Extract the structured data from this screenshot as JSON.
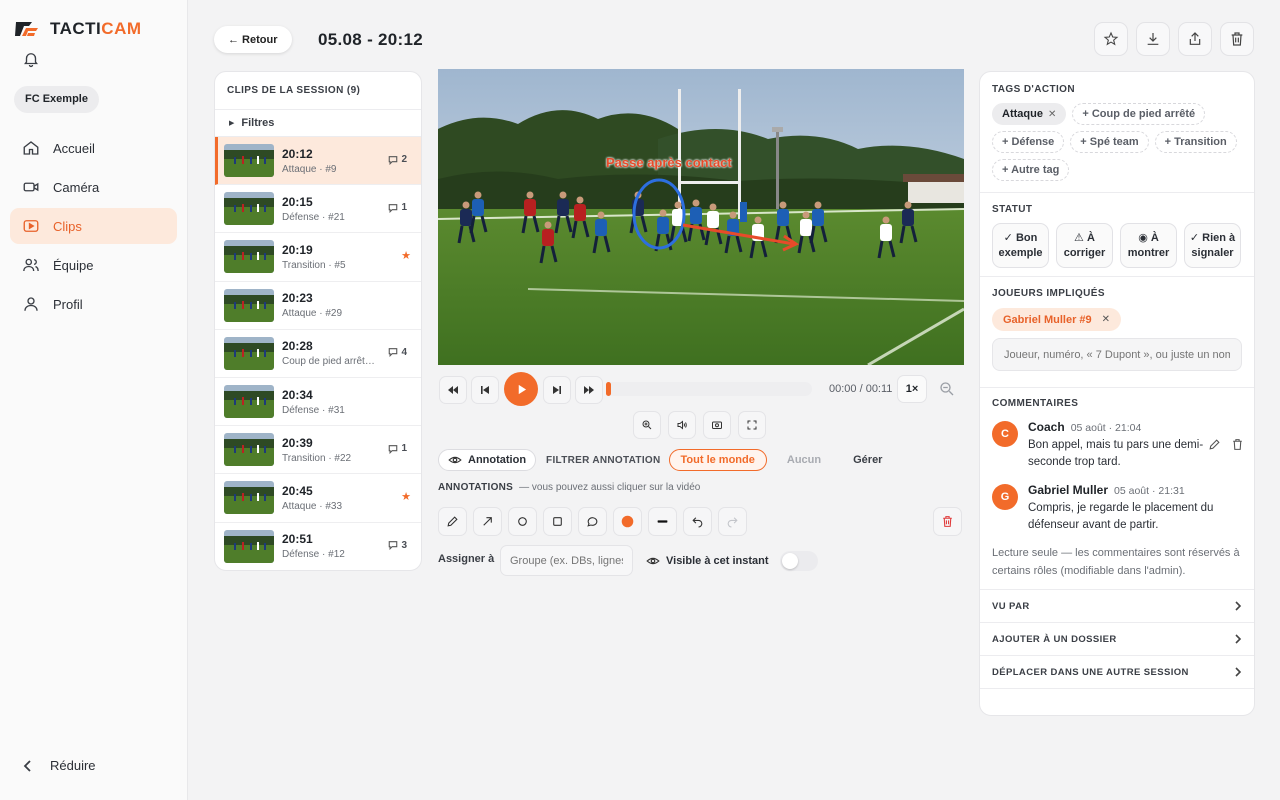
{
  "app": {
    "brand_prefix": "TACTI",
    "brand_suffix": "CAM",
    "team": "FC Exemple",
    "accent": "#f26b2a"
  },
  "nav": {
    "items": [
      {
        "label": "Accueil",
        "icon": "home-icon"
      },
      {
        "label": "Caméra",
        "icon": "camera-icon"
      },
      {
        "label": "Clips",
        "icon": "clips-icon",
        "active": true
      },
      {
        "label": "Équipe",
        "icon": "team-icon"
      },
      {
        "label": "Profil",
        "icon": "profile-icon"
      }
    ],
    "collapse": "Réduire"
  },
  "header": {
    "back": "← Retour",
    "title": "05.08 - 20:12"
  },
  "clips": {
    "title": "CLIPS DE LA SESSION (9)",
    "filters": "Filtres",
    "items": [
      {
        "time": "20:12",
        "sub": "Attaque · #9",
        "badge": "2"
      },
      {
        "time": "20:15",
        "sub": "Défense · #21",
        "badge": "1"
      },
      {
        "time": "20:19",
        "sub": "Transition · #5",
        "badge": "★"
      },
      {
        "time": "20:23",
        "sub": "Attaque · #29",
        "badge": ""
      },
      {
        "time": "20:28",
        "sub": "Coup de pied arrêt…",
        "badge": "4"
      },
      {
        "time": "20:34",
        "sub": "Défense · #31",
        "badge": ""
      },
      {
        "time": "20:39",
        "sub": "Transition · #22",
        "badge": "1"
      },
      {
        "time": "20:45",
        "sub": "Attaque · #33",
        "badge": "★"
      },
      {
        "time": "20:51",
        "sub": "Défense · #12",
        "badge": "3"
      }
    ]
  },
  "video": {
    "overlay_label": "Passe après contact",
    "time": "00:00 / 00:11",
    "speed": "1×",
    "progress": 0
  },
  "annotation": {
    "toggle": "Annotation",
    "filter_label": "FILTRER ANNOTATION",
    "filters": [
      "Tout le monde",
      "Aucun",
      "Gérer"
    ],
    "title": "ANNOTATIONS",
    "hint": "— vous pouvez aussi cliquer sur la vidéo",
    "assign_label": "Assigner à",
    "assign_placeholder": "Groupe (ex. DBs, lignes…)",
    "visible_label": "Visible à cet instant",
    "color": "#f26b2a"
  },
  "tags": {
    "title": "TAGS D'ACTION",
    "active": "Attaque",
    "options": [
      "+ Coup de pied arrêté",
      "+ Défense",
      "+ Spé team",
      "+ Transition",
      "+ Autre tag"
    ]
  },
  "statut": {
    "title": "STATUT",
    "options": [
      {
        "icon": "✓",
        "line1": "Bon",
        "line2": "exemple"
      },
      {
        "icon": "⚠",
        "line1": "À",
        "line2": "corriger"
      },
      {
        "icon": "◉",
        "line1": "À",
        "line2": "montrer"
      },
      {
        "icon": "✓",
        "line1": "Rien à",
        "line2": "signaler"
      }
    ]
  },
  "joueurs": {
    "title": "JOUEURS IMPLIQUÉS",
    "chip": "Gabriel Muller #9",
    "placeholder": "Joueur, numéro, « 7 Dupont », ou juste un nom"
  },
  "comments": {
    "title": "COMMENTAIRES",
    "items": [
      {
        "initial": "C",
        "author": "Coach",
        "date": "05 août · 21:04",
        "text": "Bon appel, mais tu pars une demi-seconde trop tard."
      },
      {
        "initial": "G",
        "author": "Gabriel Muller",
        "date": "05 août · 21:31",
        "text": "Compris, je regarde le placement du défenseur avant de partir."
      }
    ],
    "readonly": "Lecture seule — les commentaires sont réservés à certains rôles (modifiable dans l'admin)."
  },
  "links": [
    "VU PAR",
    "AJOUTER À UN DOSSIER",
    "DÉPLACER DANS UNE AUTRE SESSION"
  ]
}
